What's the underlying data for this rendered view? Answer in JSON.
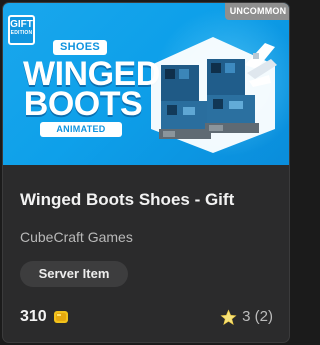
{
  "card": {
    "badges": {
      "gift_line1": "GIFT",
      "gift_line2": "EDITION",
      "rarity": "UNCOMMON"
    },
    "art": {
      "category_pill": "SHOES",
      "title_line1": "WINGED",
      "title_line2": "BOOTS",
      "subtitle_pill": "ANIMATED"
    },
    "title": "Winged Boots Shoes - Gift",
    "creator": "CubeCraft Games",
    "item_type": "Server Item",
    "price": "310",
    "rating_text": "3 (2)",
    "icons": {
      "currency": "coin-icon",
      "rating": "star-icon",
      "gift": "gift-icon"
    },
    "colors": {
      "art_background": "#0ea0ea",
      "card_background": "#2b2b2c",
      "rarity_badge": "#8f8f8f",
      "coin": "#f2c21b",
      "star": "#f6e27a"
    }
  }
}
